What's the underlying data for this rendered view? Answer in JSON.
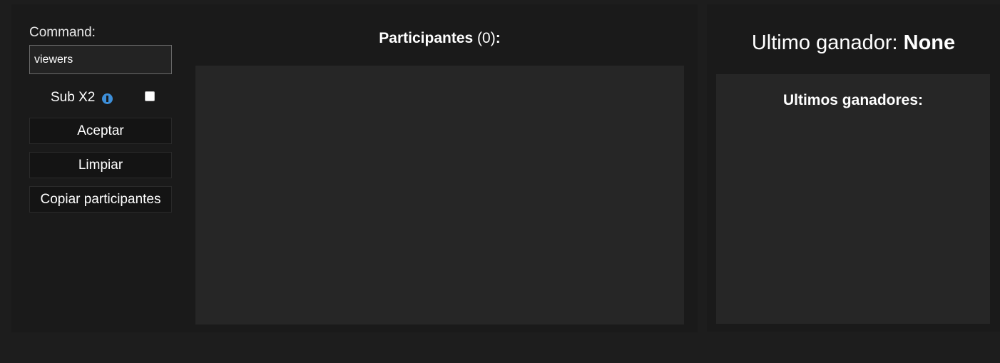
{
  "command": {
    "label": "Command:",
    "value": "viewers"
  },
  "sub": {
    "label": "Sub X2",
    "icon": "info-icon",
    "checked": false
  },
  "buttons": {
    "accept": "Aceptar",
    "clear": "Limpiar",
    "copy": "Copiar participantes"
  },
  "participants": {
    "title": "Participantes",
    "count": "(0)",
    "suffix": ":"
  },
  "last_winner": {
    "label": "Ultimo ganador:",
    "value": "None"
  },
  "winners": {
    "title": "Ultimos ganadores:"
  },
  "colors": {
    "background": "#1d1d1d",
    "panel": "#1a1a1a",
    "box": "#262626",
    "info_icon": "#3d8fd9"
  }
}
